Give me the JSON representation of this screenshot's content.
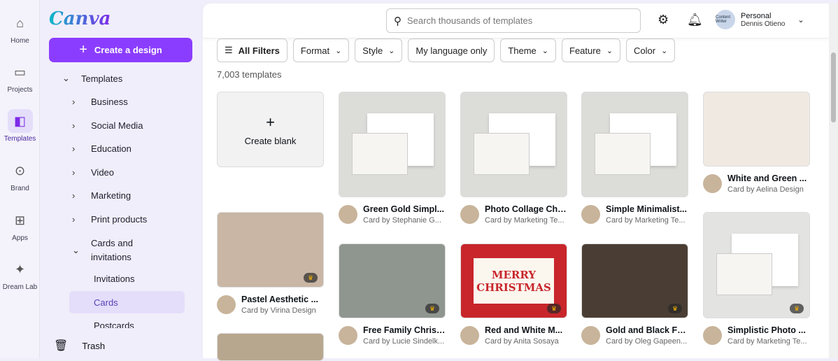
{
  "rail": [
    {
      "label": "Home",
      "icon": "home-icon",
      "glyph": "⌂"
    },
    {
      "label": "Projects",
      "icon": "folder-icon",
      "glyph": "▭"
    },
    {
      "label": "Templates",
      "icon": "templates-icon",
      "glyph": "◧",
      "active": true
    },
    {
      "label": "Brand",
      "icon": "brand-icon",
      "glyph": "⊙"
    },
    {
      "label": "Apps",
      "icon": "apps-icon",
      "glyph": "⊞"
    },
    {
      "label": "Dream Lab",
      "icon": "dream-lab-icon",
      "glyph": "✦"
    }
  ],
  "logo": "Canva",
  "create_label": "Create a design",
  "nav": {
    "templates": "Templates",
    "items": [
      "Business",
      "Social Media",
      "Education",
      "Video",
      "Marketing",
      "Print products"
    ],
    "cards_inv": "Cards and invitations",
    "sub": [
      "Invitations",
      "Cards",
      "Postcards"
    ],
    "trash": "Trash"
  },
  "search": {
    "placeholder": "Search thousands of templates"
  },
  "account": {
    "name": "Personal",
    "user": "Dennis Otieno",
    "avatar_text": "Content Writer"
  },
  "filters": [
    "All Filters",
    "Format",
    "Style",
    "My language only",
    "Theme",
    "Feature",
    "Color"
  ],
  "count": "7,003 templates",
  "create_blank": "Create blank",
  "cards": [
    {
      "title": "Pastel Aesthetic ...",
      "by": "Card by Virina Design",
      "color": "#c9b6a4",
      "premium": true
    },
    {
      "title": "Green Gold Simpl...",
      "by": "Card by Stephanie G...",
      "color": "#dcdcd9"
    },
    {
      "title": "Photo Collage Chr...",
      "by": "Card by Marketing Te...",
      "color": "#dcdcd9"
    },
    {
      "title": "Simple Minimalist...",
      "by": "Card by Marketing Te...",
      "color": "#dcdcd9"
    },
    {
      "title": "White and Green ...",
      "by": "Card by Aelina Design",
      "color": "#efe9e2"
    },
    {
      "title": "Free Family Christ...",
      "by": "Card by Lucie Sindelk...",
      "color": "#8f958f",
      "premium": true
    },
    {
      "title": "Red and White M...",
      "by": "Card by Anita Sosaya",
      "color": "#c8262b",
      "premium": true,
      "text": "MERRY CHRISTMAS"
    },
    {
      "title": "Gold and Black Fa...",
      "by": "Card by Oleg Gapeen...",
      "color": "#4a3e34",
      "premium": true
    },
    {
      "title": "Simplistic Photo ...",
      "by": "Card by Marketing Te...",
      "color": "#e3e3e1",
      "premium": true
    }
  ]
}
